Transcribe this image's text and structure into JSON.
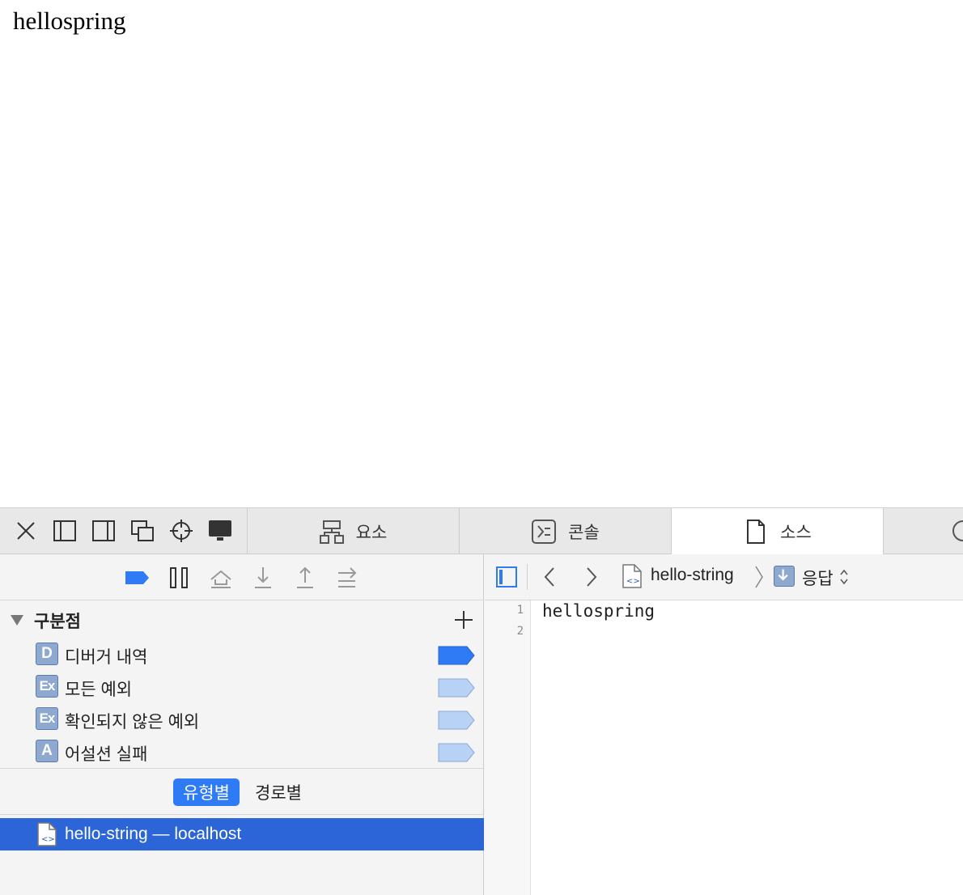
{
  "page": {
    "text": "hellospring"
  },
  "devtools": {
    "tabs": [
      {
        "label": "요소",
        "icon": "elements-icon"
      },
      {
        "label": "콘솔",
        "icon": "console-icon"
      },
      {
        "label": "소스",
        "icon": "document-icon",
        "active": true
      }
    ],
    "window_buttons": [
      "close-icon",
      "dock-left-icon",
      "dock-right-icon",
      "detach-window-icon",
      "inspect-crosshair-icon",
      "device-screen-icon"
    ],
    "debugger_toolbar": [
      "breakpoints-toggle-icon",
      "pause-icon",
      "step-over-icon",
      "step-into-icon",
      "step-out-icon",
      "continue-icon"
    ],
    "breakpoints": {
      "title": "구분점",
      "items": [
        {
          "badge": "D",
          "label": "디버거 내역",
          "enabled": true
        },
        {
          "badge": "Ex",
          "label": "모든 예외",
          "enabled": false
        },
        {
          "badge": "Ex",
          "label": "확인되지 않은 예외",
          "enabled": false
        },
        {
          "badge": "A",
          "label": "어설션 실패",
          "enabled": false
        }
      ]
    },
    "scope": {
      "by_type": "유형별",
      "by_path": "경로별"
    },
    "resource": {
      "label": "hello-string — localhost"
    },
    "source": {
      "breadcrumb_file": "hello-string",
      "breadcrumb_response": "응답",
      "lines": [
        "hellospring",
        ""
      ]
    },
    "colors": {
      "accent": "#2f7bf5",
      "selection": "#2c65d8",
      "badge": "#8ea8d0"
    }
  }
}
